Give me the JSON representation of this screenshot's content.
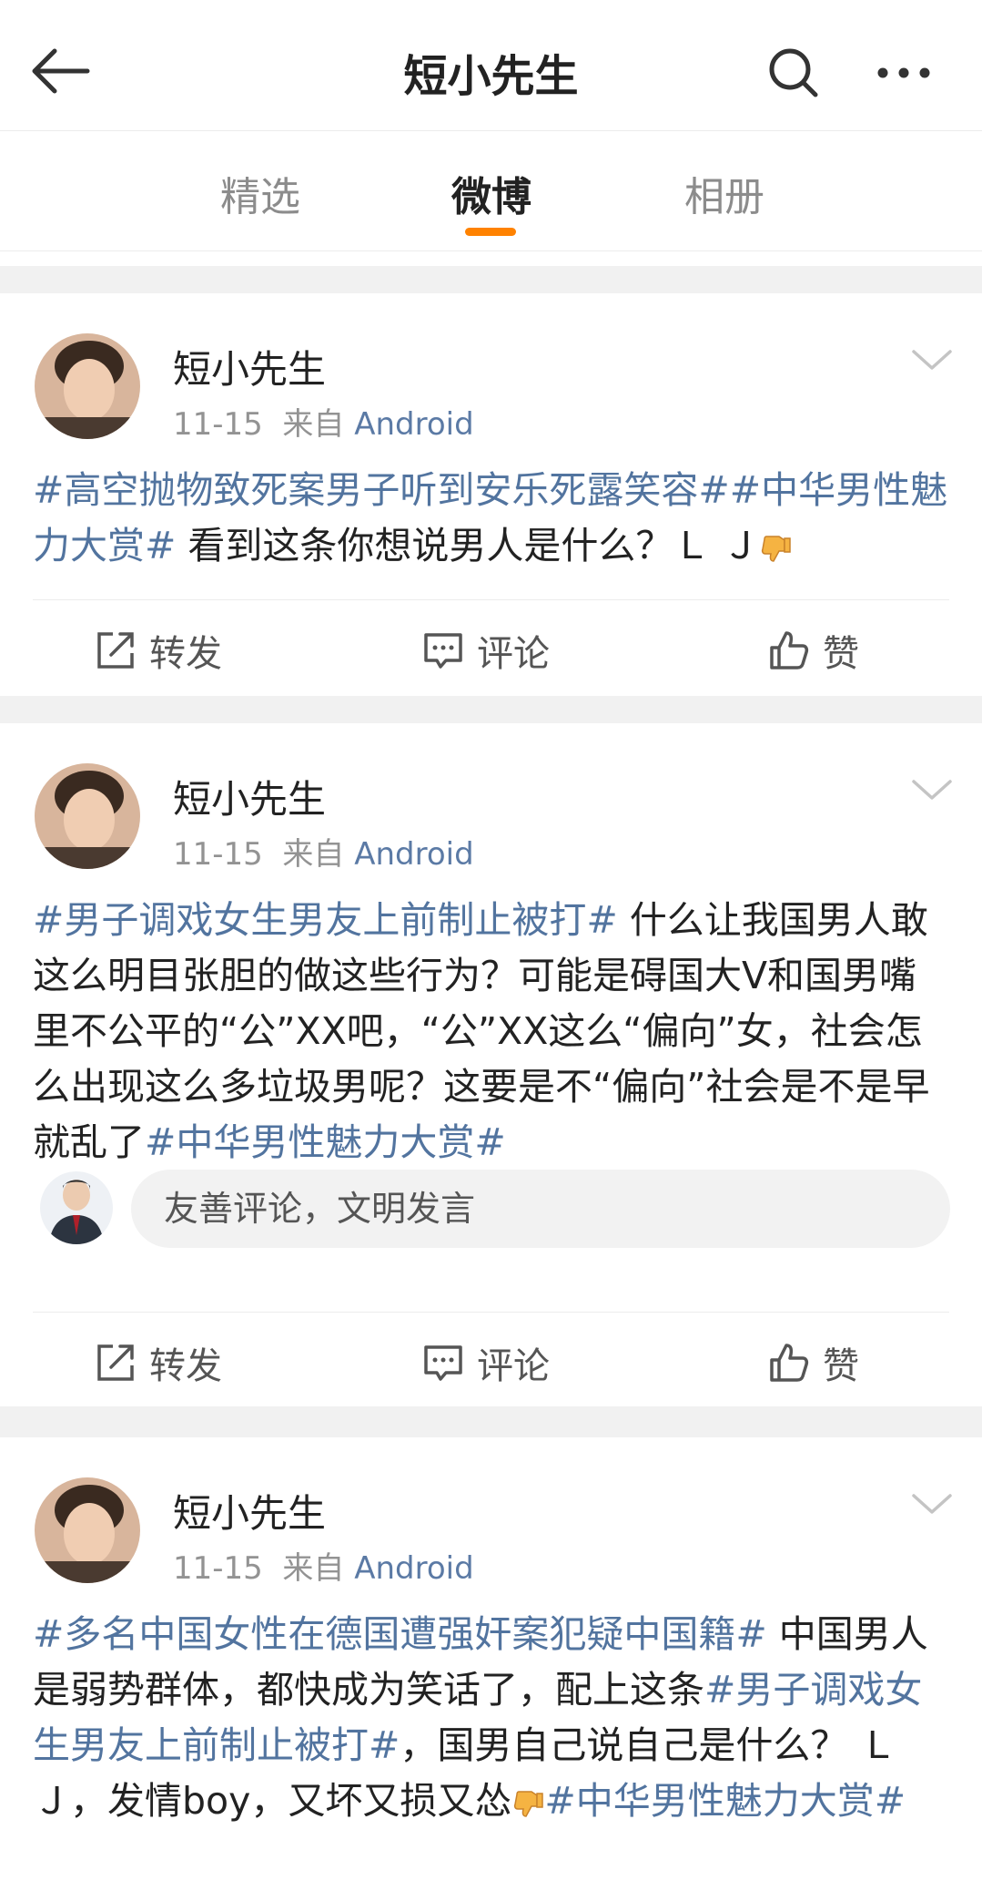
{
  "header": {
    "title": "短小先生"
  },
  "tabs": [
    {
      "label": "精选"
    },
    {
      "label": "微博"
    },
    {
      "label": "相册"
    }
  ],
  "posts": [
    {
      "author": "短小先生",
      "date": "11-15",
      "source_prefix": "来自",
      "source": "Android",
      "segments": [
        {
          "t": "#高空抛物致死案男子听到安乐死露笑容#",
          "tag": true
        },
        {
          "t": "#中华男性魅力大赏#",
          "tag": true
        },
        {
          "t": " 看到这条你想说男人是什么？Ｌ Ｊ",
          "tag": false
        }
      ]
    },
    {
      "author": "短小先生",
      "date": "11-15",
      "source_prefix": "来自",
      "source": "Android",
      "segments": [
        {
          "t": "#男子调戏女生男友上前制止被打#",
          "tag": true
        },
        {
          "t": " 什么让我国男人敢这么明目张胆的做这些行为？可能是碍国大V和国男嘴里不公平的“公”XX吧，“公”XX这么“偏向”女，社会怎么出现这么多垃圾男呢？这要是不“偏向”社会是不是早就乱了",
          "tag": false
        },
        {
          "t": "#中华男性魅力大赏#",
          "tag": true
        }
      ],
      "comment_placeholder": "友善评论，文明发言"
    },
    {
      "author": "短小先生",
      "date": "11-15",
      "source_prefix": "来自",
      "source": "Android",
      "segments": [
        {
          "t": "#多名中国女性在德国遭强奸案犯疑中国籍#",
          "tag": true
        },
        {
          "t": " 中国男人是弱势群体，都快成为笑话了，配上这条",
          "tag": false
        },
        {
          "t": "#男子调戏女生男友上前制止被打#",
          "tag": true
        },
        {
          "t": "，国男自己说自己是什么？ Ｌ Ｊ，发情boy，又坏又损又怂",
          "tag": false
        },
        {
          "t": "#中华男性魅力大赏#",
          "tag": true
        }
      ]
    }
  ],
  "actions": {
    "repost": "转发",
    "comment": "评论",
    "like": "赞"
  },
  "colors": {
    "accent": "#ff8200",
    "link": "#52749f",
    "gap": "#f1f1f1"
  },
  "icons": [
    "back-arrow-icon",
    "search-icon",
    "more-icon",
    "chevron-down-icon",
    "repost-icon",
    "comment-icon",
    "like-icon",
    "thumbs-down-emoji-icon"
  ]
}
